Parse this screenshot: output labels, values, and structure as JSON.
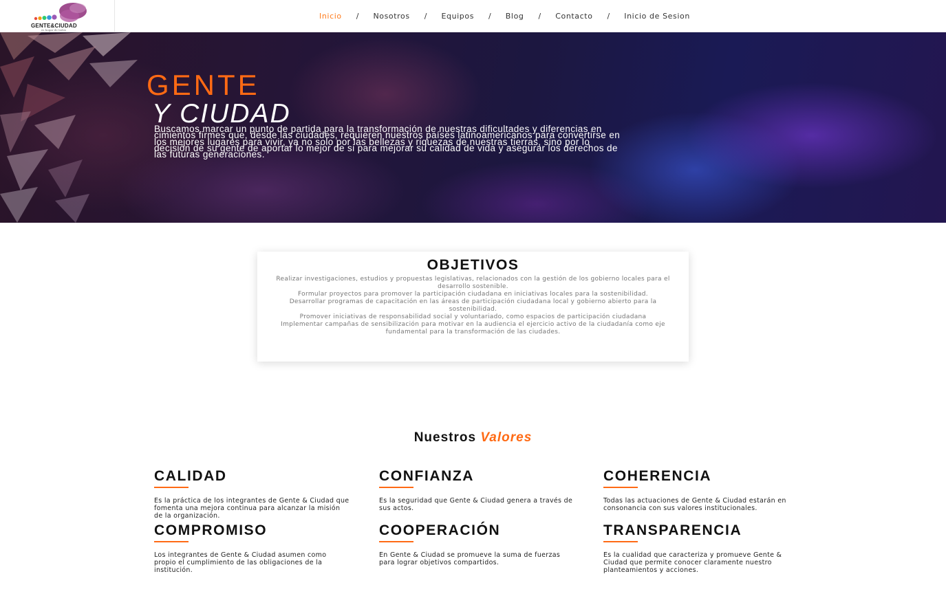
{
  "logo": {
    "name": "GENTE&CIUDAD",
    "tagline": "es hogar de todos"
  },
  "nav": {
    "items": [
      {
        "label": "Inicio",
        "active": true
      },
      {
        "label": "Nosotros"
      },
      {
        "label": "Equipos"
      },
      {
        "label": "Blog"
      },
      {
        "label": "Contacto"
      },
      {
        "label": "Inicio de Sesion"
      }
    ],
    "separator": "/"
  },
  "hero": {
    "title_line1": "GENTE",
    "title_line2": "Y CIUDAD",
    "description": "Buscamos marcar un punto de partida para la transformación de nuestras dificultades y diferencias en cimientos firmes que, desde las ciudades, requieren nuestros países latinoamericanos para convertirse en los mejores lugares para vivir, ya no solo por las bellezas y riquezas de nuestras tierras, sino por lo decisión de su gente de aportar lo mejor de si para mejorar su calidad de vida y asegurar los derechos de las futuras generaciones."
  },
  "objetivos": {
    "title": "OBJETIVOS",
    "items": [
      "Realizar investigaciones, estudios y propuestas legislativas, relacionados con la gestión de los gobierno locales para el desarrollo sostenible.",
      "Formular proyectos para promover la participación ciudadana en iniciativas locales para la sostenibilidad.",
      "Desarrollar programas de capacitación en las áreas de participación ciudadana local y gobierno abierto para la sostenibilidad.",
      "Promover iniciativas de responsabilidad social y voluntariado, como espacios de participación ciudadana",
      "Implementar campañas de sensibilización para motivar en la audiencia el ejercicio activo de la ciudadanía como eje fundamental para la transformación de las ciudades."
    ]
  },
  "valores": {
    "heading_word1": "Nuestros",
    "heading_word2": "Valores",
    "items": [
      {
        "name": "CALIDAD",
        "text": "Es la práctica de los integrantes de Gente & Ciudad que fomenta una mejora continua para alcanzar la misión de la organización."
      },
      {
        "name": "CONFIANZA",
        "text": "Es la seguridad que Gente & Ciudad genera a través de sus actos."
      },
      {
        "name": "COHERENCIA",
        "text": "Todas las actuaciones de Gente & Ciudad estarán en consonancia con sus valores institucionales."
      },
      {
        "name": "COMPROMISO",
        "text": "Los integrantes de Gente & Ciudad asumen como propio el cumplimiento de las obligaciones de la institución."
      },
      {
        "name": "COOPERACIÓN",
        "text": "En Gente & Ciudad se promueve la suma de fuerzas para lograr objetivos compartidos."
      },
      {
        "name": "TRANSPARENCIA",
        "text": "Es la cualidad que caracteriza y promueve Gente & Ciudad que permite conocer claramente nuestro planteamientos y acciones."
      }
    ]
  },
  "colors": {
    "accent": "#ff6a14",
    "nav_active": "#ff7a1a"
  }
}
